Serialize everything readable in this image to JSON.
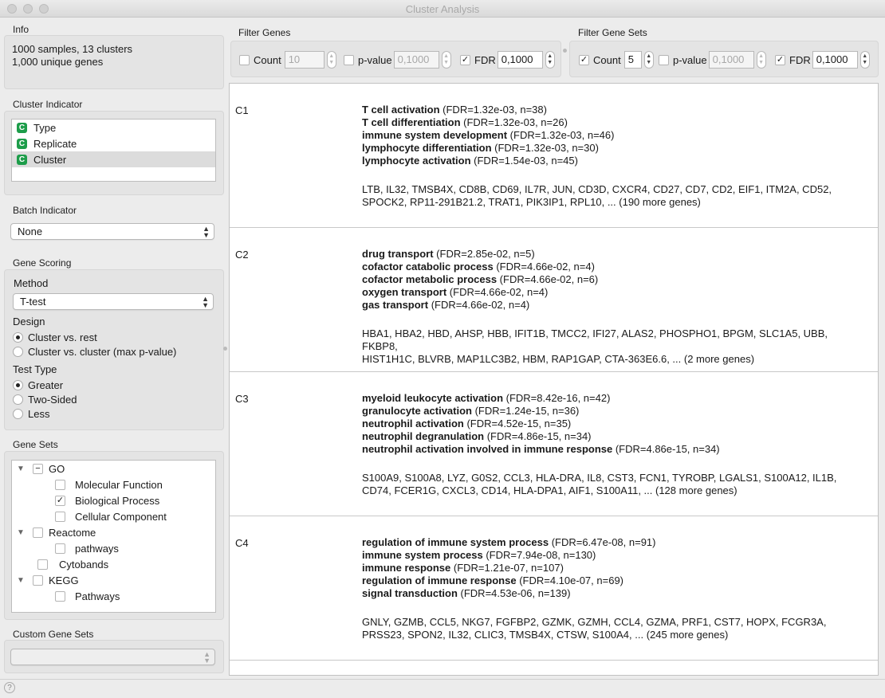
{
  "window": {
    "title": "Cluster Analysis"
  },
  "info": {
    "label": "Info",
    "line1": "1000 samples, 13 clusters",
    "line2": "1,000 unique genes"
  },
  "cluster_indicator": {
    "label": "Cluster Indicator",
    "items": [
      {
        "badge": "C",
        "label": "Type"
      },
      {
        "badge": "C",
        "label": "Replicate"
      },
      {
        "badge": "C",
        "label": "Cluster",
        "selected": true
      }
    ]
  },
  "batch_indicator": {
    "label": "Batch Indicator",
    "value": "None"
  },
  "gene_scoring": {
    "label": "Gene Scoring",
    "method_label": "Method",
    "method_value": "T-test",
    "design_label": "Design",
    "design_options": [
      "Cluster vs. rest",
      "Cluster vs. cluster (max p-value)"
    ],
    "test_type_label": "Test Type",
    "test_type_options": [
      "Greater",
      "Two-Sided",
      "Less"
    ]
  },
  "gene_sets": {
    "label": "Gene Sets",
    "tree": [
      {
        "label": "GO",
        "expanded": true,
        "check": "−"
      },
      {
        "label": "Molecular Function",
        "check": ""
      },
      {
        "label": "Biological Process",
        "check": "✓"
      },
      {
        "label": "Cellular Component",
        "check": ""
      },
      {
        "label": "Reactome",
        "expanded": true,
        "check": ""
      },
      {
        "label": "pathways",
        "check": ""
      },
      {
        "label": "Cytobands",
        "check": ""
      },
      {
        "label": "KEGG",
        "expanded": true,
        "check": ""
      },
      {
        "label": "Pathways",
        "check": ""
      }
    ]
  },
  "custom_gene_sets": {
    "label": "Custom Gene Sets",
    "value": ""
  },
  "filter_genes": {
    "label": "Filter Genes",
    "count_label": "Count",
    "count_value": "10",
    "pvalue_label": "p-value",
    "pvalue_value": "0,1000",
    "fdr_label": "FDR",
    "fdr_value": "0,1000"
  },
  "filter_gene_sets": {
    "label": "Filter Gene Sets",
    "count_label": "Count",
    "count_value": "5",
    "pvalue_label": "p-value",
    "pvalue_value": "0,1000",
    "fdr_label": "FDR",
    "fdr_value": "0,1000"
  },
  "clusters": [
    {
      "id": "C1",
      "terms": [
        {
          "name": "T cell activation",
          "stats": " (FDR=1.32e-03, n=38)"
        },
        {
          "name": "T cell differentiation",
          "stats": " (FDR=1.32e-03, n=26)"
        },
        {
          "name": "immune system development",
          "stats": " (FDR=1.32e-03, n=46)"
        },
        {
          "name": "lymphocyte differentiation",
          "stats": " (FDR=1.32e-03, n=30)"
        },
        {
          "name": "lymphocyte activation",
          "stats": " (FDR=1.54e-03, n=45)"
        }
      ],
      "genes_line1": "LTB, IL32, TMSB4X, CD8B, CD69, IL7R, JUN, CD3D, CXCR4, CD27, CD7, CD2, EIF1, ITM2A, CD52,",
      "genes_line2": "SPOCK2, RP11-291B21.2, TRAT1, PIK3IP1, RPL10, ... (190 more genes)"
    },
    {
      "id": "C2",
      "terms": [
        {
          "name": "drug transport",
          "stats": " (FDR=2.85e-02, n=5)"
        },
        {
          "name": "cofactor catabolic process",
          "stats": " (FDR=4.66e-02, n=4)"
        },
        {
          "name": "cofactor metabolic process",
          "stats": " (FDR=4.66e-02, n=6)"
        },
        {
          "name": "oxygen transport",
          "stats": " (FDR=4.66e-02, n=4)"
        },
        {
          "name": "gas transport",
          "stats": " (FDR=4.66e-02, n=4)"
        }
      ],
      "genes_line1": "HBA1, HBA2, HBD, AHSP, HBB, IFIT1B, TMCC2, IFI27, ALAS2, PHOSPHO1, BPGM, SLC1A5, UBB, FKBP8,",
      "genes_line2": "HIST1H1C, BLVRB, MAP1LC3B2, HBM, RAP1GAP, CTA-363E6.6, ... (2 more genes)"
    },
    {
      "id": "C3",
      "terms": [
        {
          "name": "myeloid leukocyte activation",
          "stats": " (FDR=8.42e-16, n=42)"
        },
        {
          "name": "granulocyte activation",
          "stats": " (FDR=1.24e-15, n=36)"
        },
        {
          "name": "neutrophil activation",
          "stats": " (FDR=4.52e-15, n=35)"
        },
        {
          "name": "neutrophil degranulation",
          "stats": " (FDR=4.86e-15, n=34)"
        },
        {
          "name": "neutrophil activation involved in immune response",
          "stats": " (FDR=4.86e-15, n=34)"
        }
      ],
      "genes_line1": "S100A9, S100A8, LYZ, G0S2, CCL3, HLA-DRA, IL8, CST3, FCN1, TYROBP, LGALS1, S100A12, IL1B,",
      "genes_line2": "CD74, FCER1G, CXCL3, CD14, HLA-DPA1, AIF1, S100A11, ... (128 more genes)"
    },
    {
      "id": "C4",
      "terms": [
        {
          "name": "regulation of immune system process",
          "stats": " (FDR=6.47e-08, n=91)"
        },
        {
          "name": "immune system process",
          "stats": " (FDR=7.94e-08, n=130)"
        },
        {
          "name": "immune response",
          "stats": " (FDR=1.21e-07, n=107)"
        },
        {
          "name": "regulation of immune response",
          "stats": " (FDR=4.10e-07, n=69)"
        },
        {
          "name": "signal transduction",
          "stats": " (FDR=4.53e-06, n=139)"
        }
      ],
      "genes_line1": "GNLY, GZMB, CCL5, NKG7, FGFBP2, GZMK, GZMH, CCL4, GZMA, PRF1, CST7, HOPX, FCGR3A,",
      "genes_line2": "PRSS23, SPON2, IL32, CLIC3, TMSB4X, CTSW, S100A4, ... (245 more genes)"
    }
  ],
  "statusbar": {
    "help_icon": "?"
  }
}
